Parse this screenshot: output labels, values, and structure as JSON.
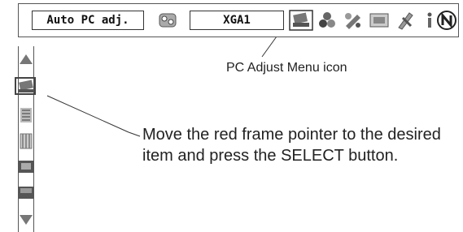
{
  "topbar": {
    "auto_pc_adj_label": "Auto PC adj.",
    "mode_label": "XGA1",
    "icons": [
      "auto-pc-adj-icon",
      "pc-adjust-menu-icon",
      "color-icon",
      "image-adjust-icon",
      "screen-icon",
      "setting-icon",
      "information-icon",
      "network-icon"
    ]
  },
  "sidebar": {
    "icons": [
      "scroll-up-icon",
      "pc-adjust-icon",
      "fine-sync-icon",
      "total-dots-icon",
      "position-icon",
      "display-area-icon",
      "scroll-down-icon"
    ]
  },
  "callout": {
    "label": "PC Adjust Menu icon"
  },
  "instruction": {
    "text": "Move the red frame pointer to the desired item and press the SELECT button."
  }
}
